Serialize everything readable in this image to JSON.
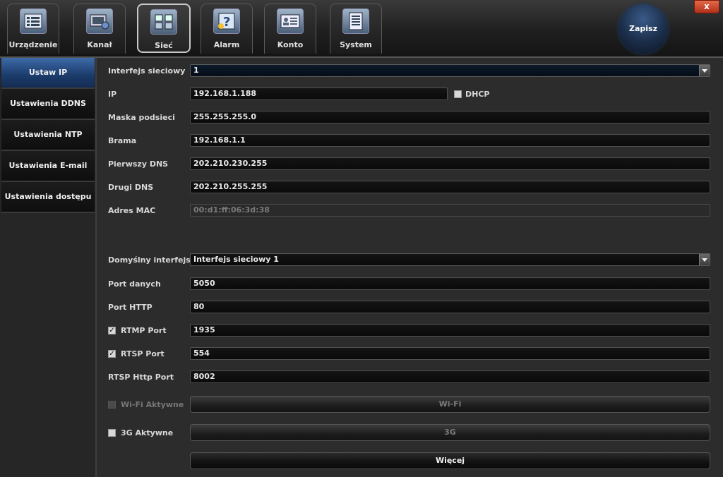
{
  "tabs": [
    {
      "label": "Urządzenie",
      "icon": "device-list-icon"
    },
    {
      "label": "Kanał",
      "icon": "channel-film-icon"
    },
    {
      "label": "Sieć",
      "icon": "network-computers-icon"
    },
    {
      "label": "Alarm",
      "icon": "alarm-question-icon"
    },
    {
      "label": "Konto",
      "icon": "account-card-icon"
    },
    {
      "label": "System",
      "icon": "system-document-icon"
    }
  ],
  "active_tab": "Sieć",
  "save_label": "Zapisz",
  "close_label": "x",
  "sidebar": {
    "items": [
      {
        "label": "Ustaw IP"
      },
      {
        "label": "Ustawienia DDNS"
      },
      {
        "label": "Ustawienia NTP"
      },
      {
        "label": "Ustawienia E-mail"
      },
      {
        "label": "Ustawienia dostępu"
      }
    ],
    "active": "Ustaw IP"
  },
  "form": {
    "interface_label": "Interfejs sieciowy",
    "interface_value": "1",
    "ip_label": "IP",
    "ip_value": "192.168.1.188",
    "dhcp_label": "DHCP",
    "dhcp_checked": false,
    "mask_label": "Maska podsieci",
    "mask_value": "255.255.255.0",
    "gateway_label": "Brama",
    "gateway_value": "192.168.1.1",
    "dns1_label": "Pierwszy DNS",
    "dns1_value": "202.210.230.255",
    "dns2_label": "Drugi DNS",
    "dns2_value": "202.210.255.255",
    "mac_label": "Adres MAC",
    "mac_value": "00:d1:ff:06:3d:38",
    "default_iface_label": "Domyślny interfejs",
    "default_iface_value": "Interfejs sieciowy 1",
    "data_port_label": "Port danych",
    "data_port_value": "5050",
    "http_port_label": "Port HTTP",
    "http_port_value": "80",
    "rtmp_label": "RTMP Port",
    "rtmp_checked": true,
    "rtmp_value": "1935",
    "rtsp_label": "RTSP Port",
    "rtsp_checked": true,
    "rtsp_value": "554",
    "rtsp_http_label": "RTSP Http Port",
    "rtsp_http_value": "8002",
    "wifi_label": "Wi-Fi Aktywne",
    "wifi_checked": false,
    "wifi_button": "Wi-Fi",
    "g3_label": "3G Aktywne",
    "g3_checked": false,
    "g3_button": "3G",
    "more_button": "Więcej",
    "check_mark": "✓"
  }
}
